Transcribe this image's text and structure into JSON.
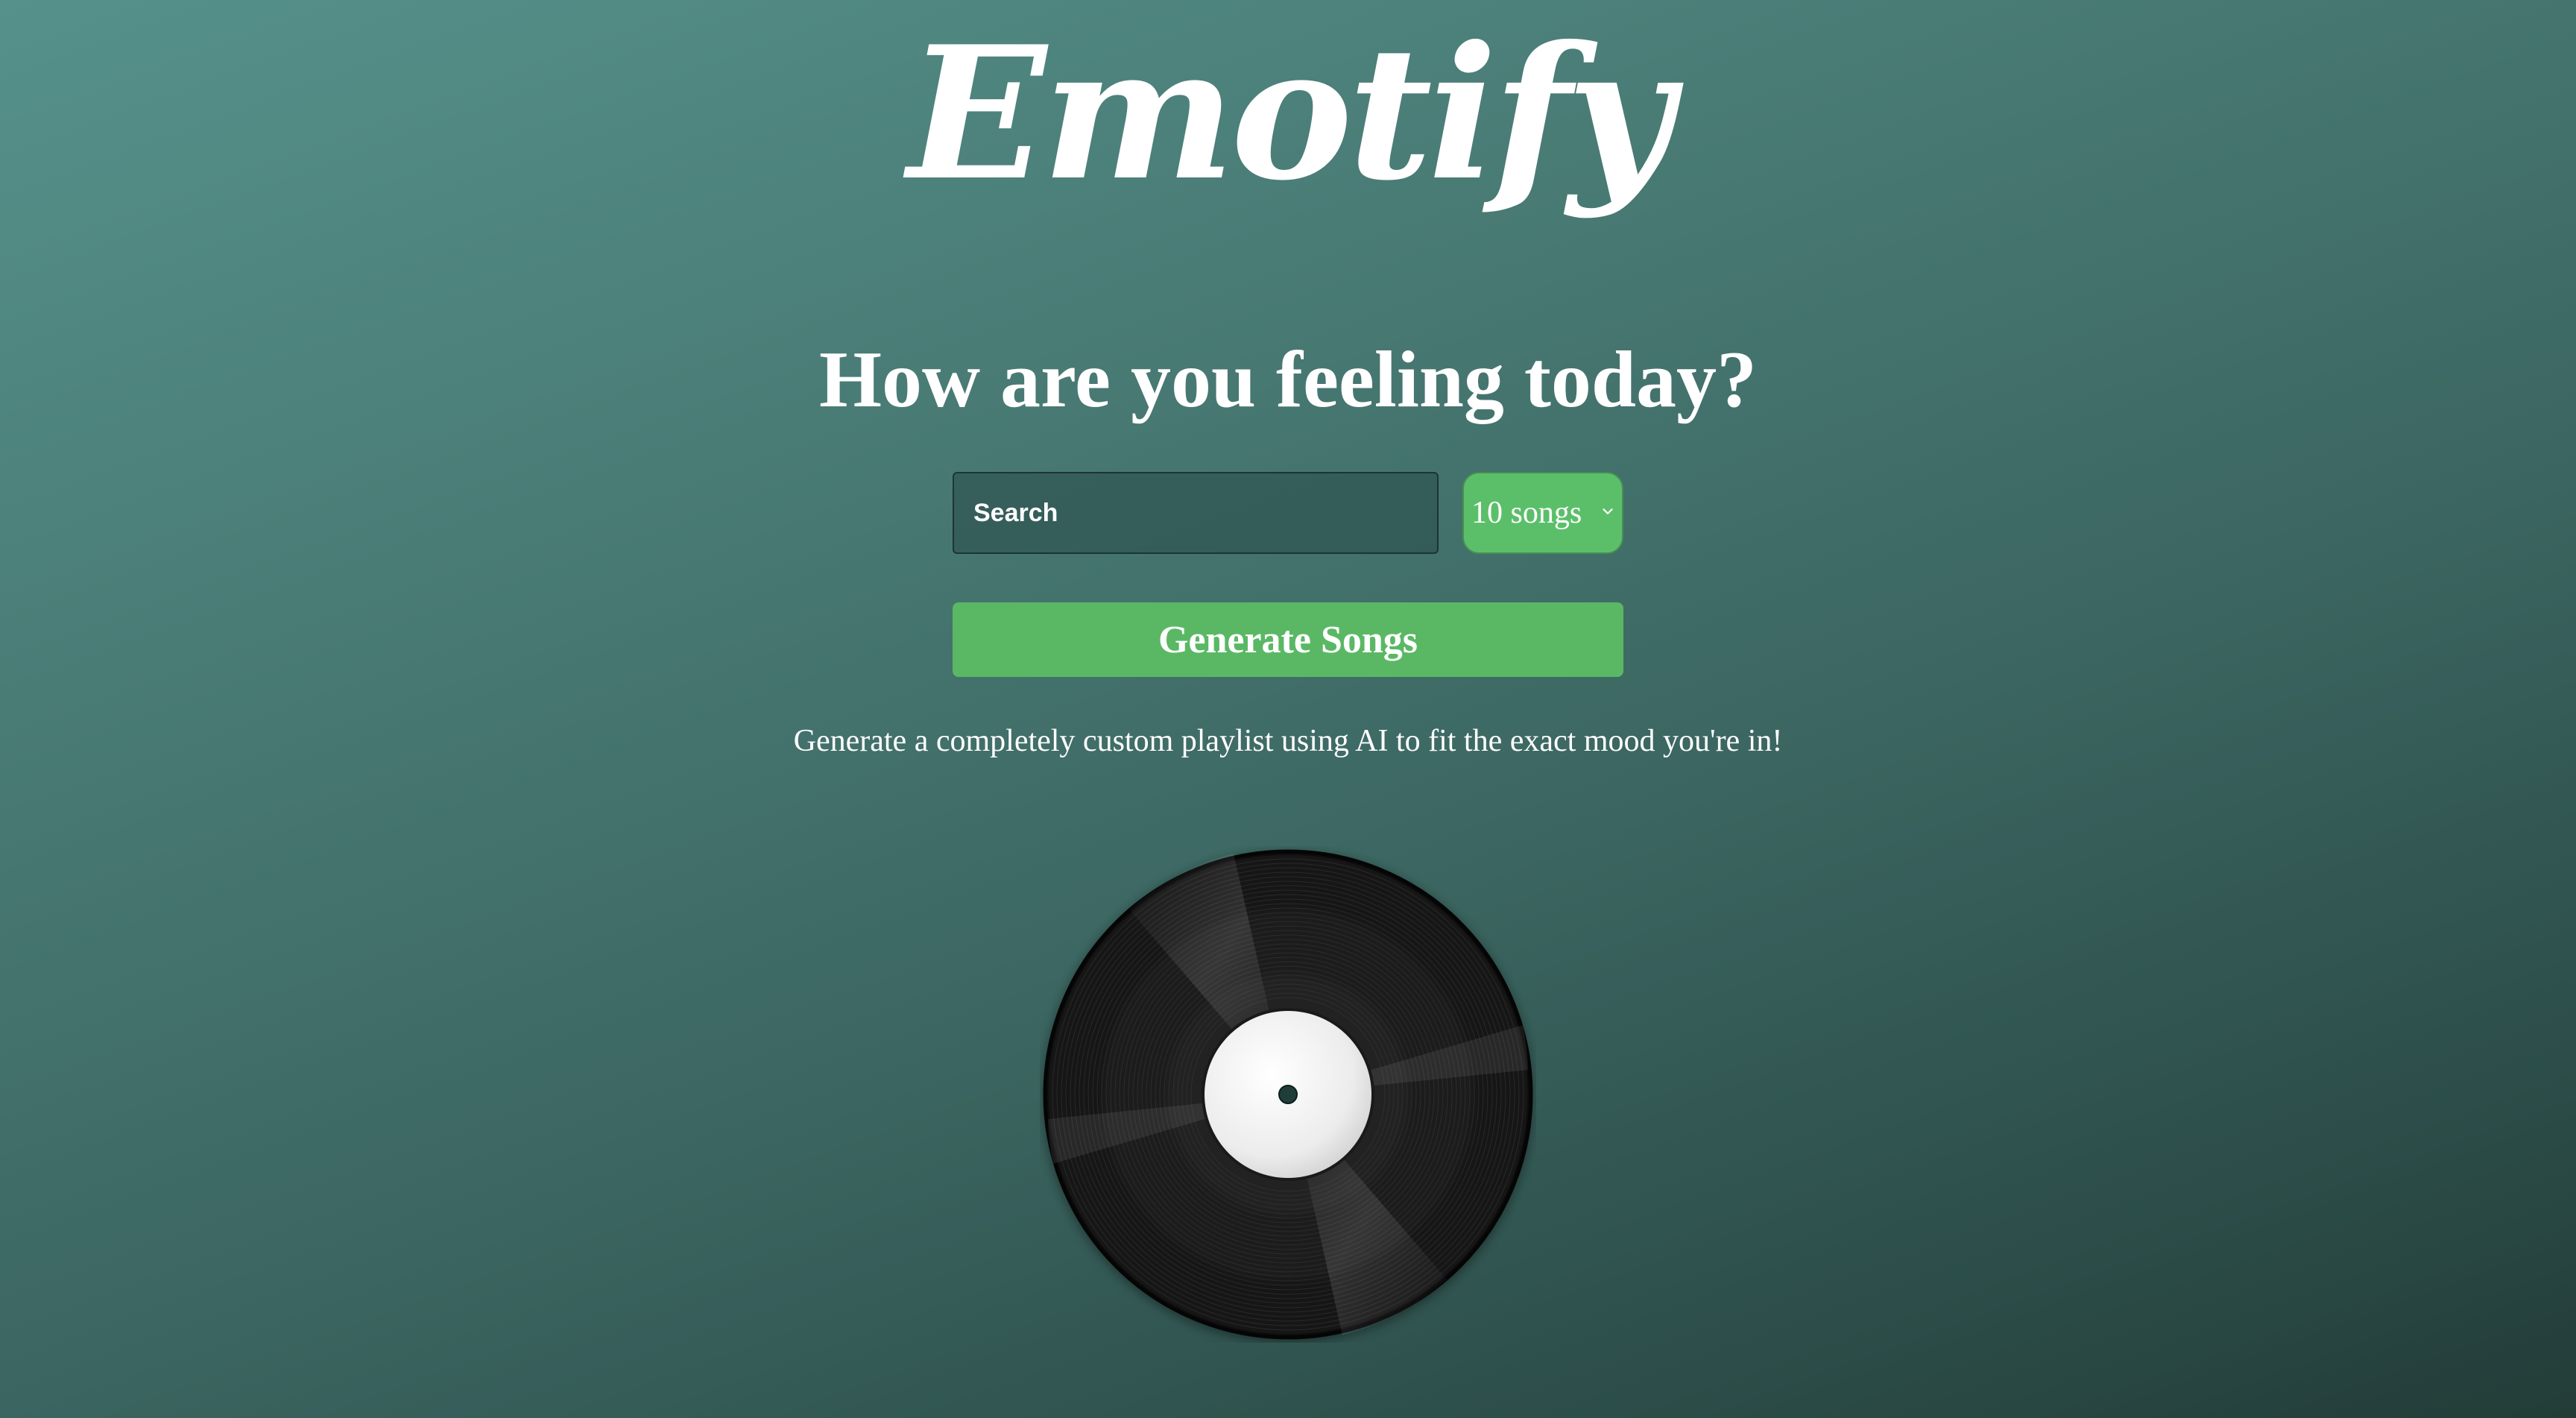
{
  "brand": {
    "logo_text": "Emotify"
  },
  "hero": {
    "headline": "How are you feeling today?",
    "tagline": "Generate a completely custom playlist using AI to fit the exact mood you're in!"
  },
  "search": {
    "placeholder": "Search",
    "value": ""
  },
  "song_count": {
    "selected": "10 songs",
    "icon": "chevron-down-icon"
  },
  "actions": {
    "generate_label": "Generate Songs"
  },
  "decor": {
    "record_icon": "vinyl-record-icon"
  },
  "colors": {
    "accent_green": "#5ab865",
    "background_top": "#56918b",
    "background_bottom": "#233c38"
  }
}
